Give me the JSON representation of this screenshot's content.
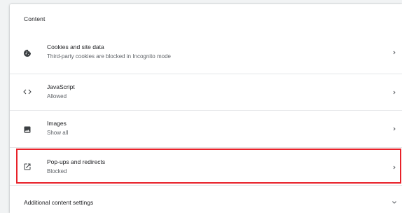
{
  "section": {
    "title": "Content"
  },
  "items": [
    {
      "icon": "cookie-icon",
      "label": "Cookies and site data",
      "sublabel": "Third-party cookies are blocked in Incognito mode"
    },
    {
      "icon": "code-brackets-icon",
      "label": "JavaScript",
      "sublabel": "Allowed"
    },
    {
      "icon": "image-icon",
      "label": "Images",
      "sublabel": "Show all"
    },
    {
      "icon": "popup-open-in-new-icon",
      "label": "Pop-ups and redirects",
      "sublabel": "Blocked"
    }
  ],
  "additional": {
    "label": "Additional content settings",
    "icon": "chevron-down-icon"
  },
  "colors": {
    "highlight_border": "#e8222a",
    "text_primary": "#202124",
    "text_secondary": "#5f6368"
  }
}
